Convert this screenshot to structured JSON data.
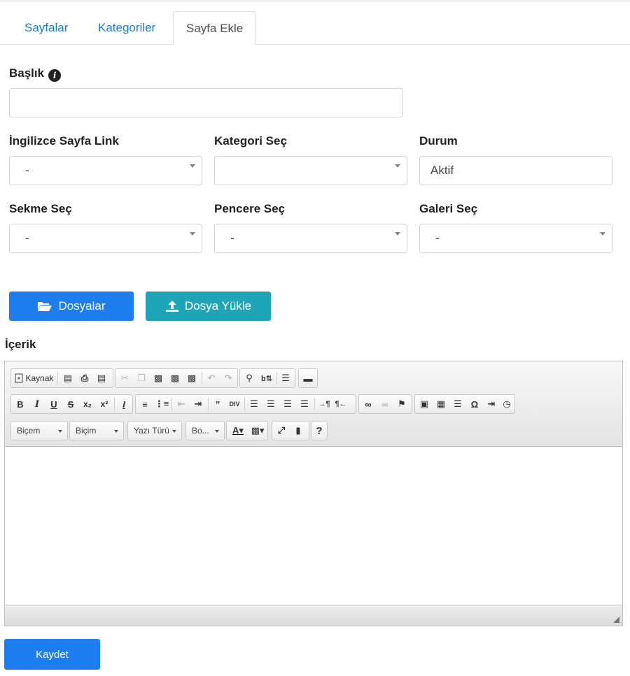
{
  "tabs": [
    {
      "label": "Sayfalar",
      "active": false
    },
    {
      "label": "Kategoriler",
      "active": false
    },
    {
      "label": "Sayfa Ekle",
      "active": true
    }
  ],
  "form": {
    "title_label": "Başlık",
    "title_value": "",
    "english_link_label": "İngilizce Sayfa Link",
    "english_link_value": "-",
    "category_label": "Kategori Seç",
    "category_value": "",
    "status_label": "Durum",
    "status_value": "Aktif",
    "tab_label": "Sekme Seç",
    "tab_value": "-",
    "window_label": "Pencere Seç",
    "window_value": "-",
    "gallery_label": "Galeri Seç",
    "gallery_value": "-"
  },
  "buttons": {
    "files": "Dosyalar",
    "upload": "Dosya Yükle",
    "save": "Kaydet"
  },
  "editor": {
    "content_label": "İçerik",
    "source_label": "Kaynak",
    "style_combo": "Biçem",
    "format_combo": "Biçim",
    "font_combo": "Yazı Türü",
    "size_combo": "Bo..."
  },
  "colors": {
    "link": "#1a7bd6",
    "primary": "#1e7ef0",
    "teal": "#1ea6b8"
  }
}
